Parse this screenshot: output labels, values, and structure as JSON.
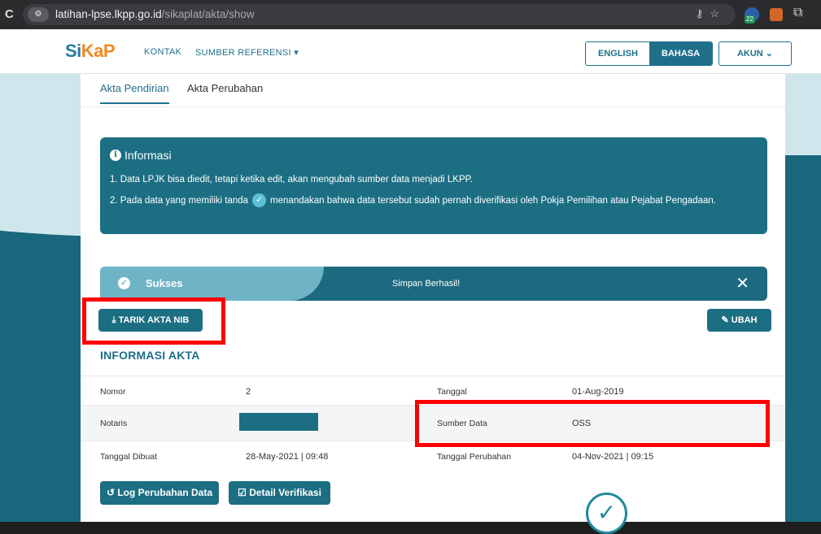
{
  "browser": {
    "url_host": "latihan-lpse.lkpp.go.id",
    "url_path": "/sikaplat/akta/show",
    "extension_badge": "22"
  },
  "navbar": {
    "logo_part1": "Si",
    "logo_part2": "KaP",
    "kontak": "KONTAK",
    "sumber_referensi": "SUMBER REFERENSI ▾",
    "english": "ENGLISH",
    "bahasa": "BAHASA",
    "akun": "AKUN  ⌄"
  },
  "tabs": [
    {
      "label": "Akta Pendirian"
    },
    {
      "label": "Akta Perubahan"
    }
  ],
  "info": {
    "title": "Informasi",
    "line1": "1. Data LPJK bisa diedit, tetapi ketika edit, akan mengubah sumber data menjadi LKPP.",
    "line2_before": "2. Pada data yang memiliki tanda",
    "line2_after": "menandakan bahwa data tersebut sudah pernah diverifikasi oleh Pokja Pemilihan atau Pejabat Pengadaan."
  },
  "success": {
    "title": "Sukses",
    "message": "Simpan Berhasil!",
    "close": "✕"
  },
  "buttons": {
    "tarik": "TARIK AKTA NIB",
    "ubah": "UBAH",
    "log": "Log Perubahan Data",
    "detail": "Detail Verifikasi"
  },
  "section": {
    "title": "INFORMASI AKTA"
  },
  "rows": [
    {
      "label1": "Nomor",
      "value1": "2",
      "label2": "Tanggal",
      "value2": "01-Aug-2019"
    },
    {
      "label1": "Notaris",
      "value1": "",
      "label2": "Sumber Data",
      "value2": "OSS"
    },
    {
      "label1": "Tanggal Dibuat",
      "value1": "28-May-2021 | 09:48",
      "label2": "Tanggal Perubahan",
      "value2": "04-Nov-2021 | 09:15"
    }
  ],
  "colors": {
    "brand": "#1f6f8b",
    "info_bg": "#1c6e83",
    "highlight": "#ff0000",
    "logo_orange": "#f08a24"
  }
}
